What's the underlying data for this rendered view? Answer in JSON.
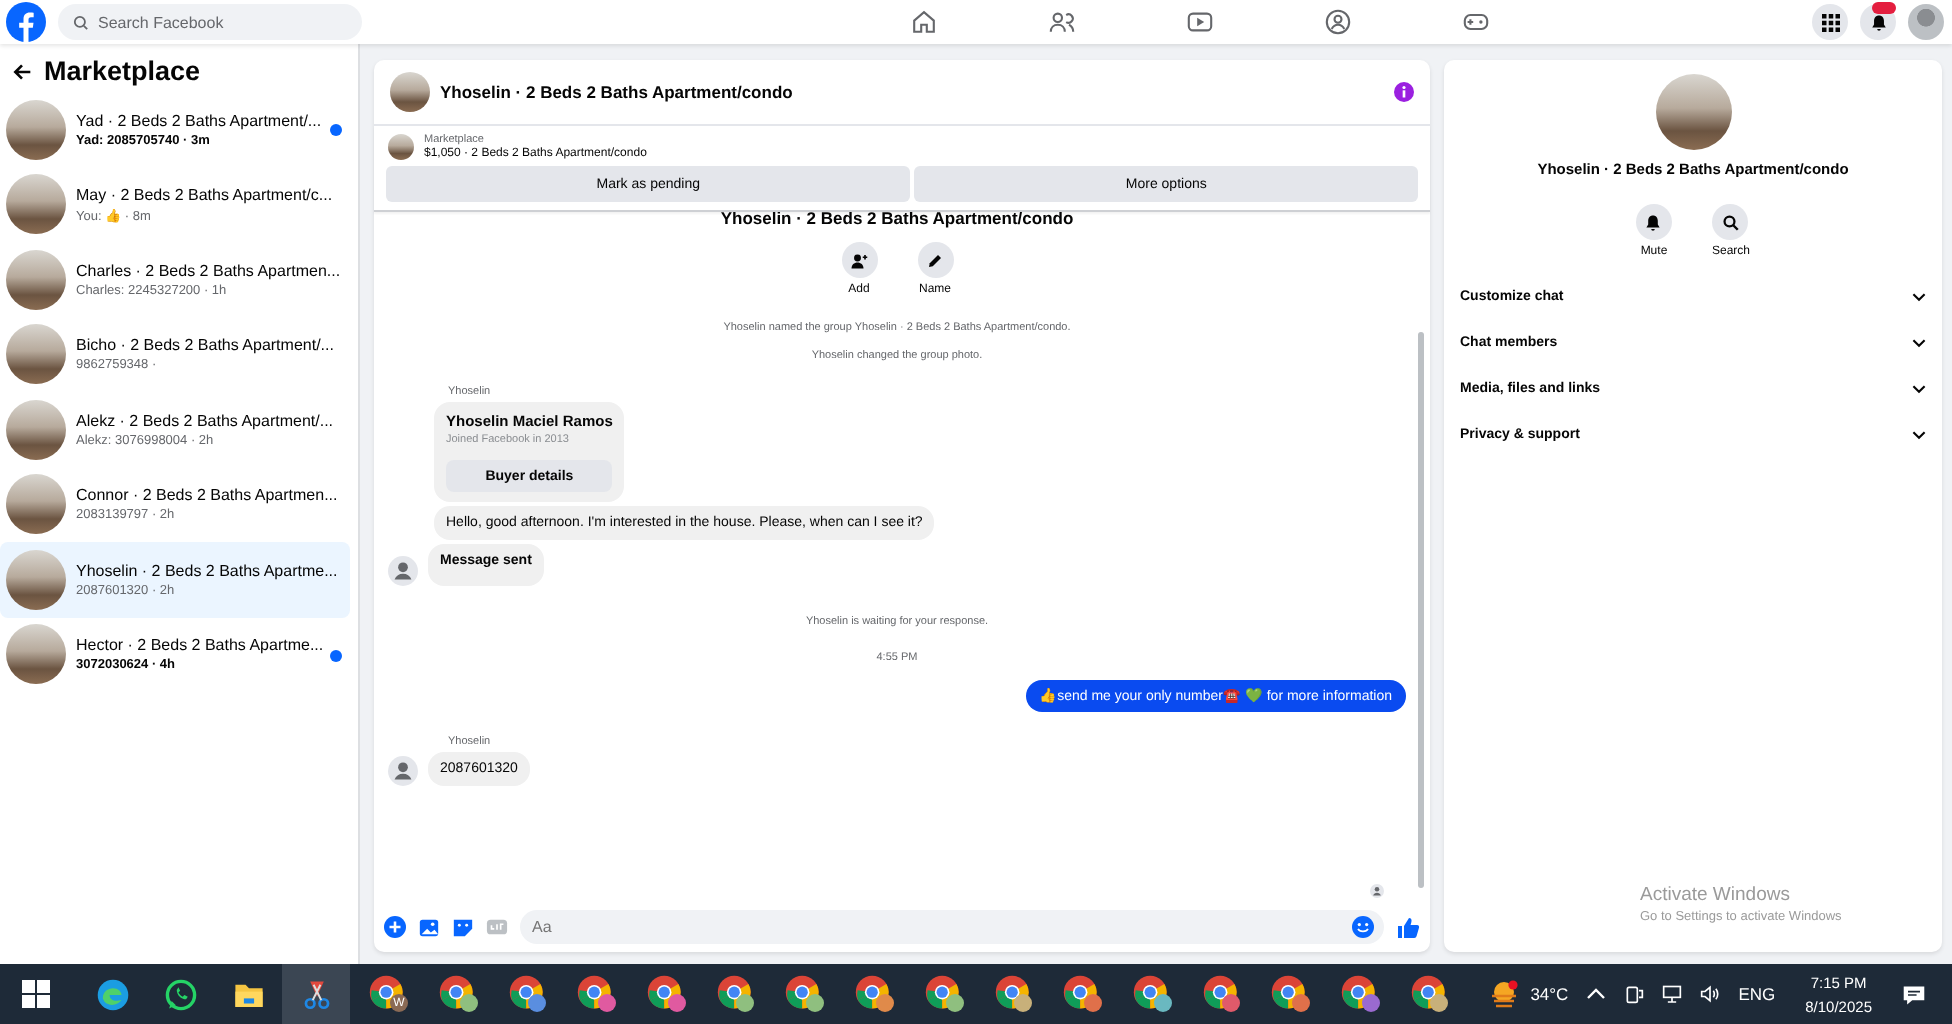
{
  "topbar": {
    "search": {
      "placeholder": "Search Facebook"
    }
  },
  "sidebar": {
    "title": "Marketplace",
    "conversations": [
      {
        "title": "Yad · 2 Beds 2 Baths Apartment/...",
        "preview": "Yad: 2085705740 · 3m",
        "unread": true,
        "selected": false
      },
      {
        "title": "May · 2 Beds 2 Baths Apartment/c...",
        "preview": "You: 👍 · 8m",
        "unread": false,
        "selected": false
      },
      {
        "title": "Charles · 2 Beds 2 Baths Apartmen...",
        "preview": "Charles: 2245327200 · 1h",
        "unread": false,
        "selected": false
      },
      {
        "title": "Bicho · 2 Beds 2 Baths Apartment/...",
        "preview": "9862759348 ·",
        "unread": false,
        "selected": false
      },
      {
        "title": "Alekz · 2 Beds 2 Baths Apartment/...",
        "preview": "Alekz: 3076998004 · 2h",
        "unread": false,
        "selected": false
      },
      {
        "title": "Connor · 2 Beds 2 Baths Apartmen...",
        "preview": "2083139797 · 2h",
        "unread": false,
        "selected": false
      },
      {
        "title": "Yhoselin · 2 Beds 2 Baths Apartme...",
        "preview": "2087601320 · 2h",
        "unread": false,
        "selected": true
      },
      {
        "title": "Hector · 2 Beds 2 Baths Apartme...",
        "preview": "3072030624 · 4h",
        "unread": true,
        "selected": false
      }
    ]
  },
  "chat": {
    "title": "Yhoselin · 2 Beds 2 Baths Apartment/condo",
    "listing": {
      "source": "Marketplace",
      "summary": "$1,050 · 2 Beds 2 Baths Apartment/condo"
    },
    "actions": [
      "Mark as pending",
      "More options"
    ],
    "group_heading": "Yhoselin · 2 Beds 2 Baths Apartment/condo",
    "group_actions": [
      {
        "kind": "add",
        "label": "Add"
      },
      {
        "kind": "name",
        "label": "Name"
      }
    ],
    "messages": [
      {
        "kind": "system",
        "text": "Yhoselin named the group Yhoselin · 2 Beds 2 Baths Apartment/condo."
      },
      {
        "kind": "system",
        "text": "Yhoselin changed the group photo."
      },
      {
        "kind": "sender",
        "text": "Yhoselin"
      },
      {
        "kind": "card",
        "name": "Yhoselin Maciel Ramos",
        "detail": "Joined Facebook in 2013",
        "button": "Buyer details"
      },
      {
        "kind": "incoming",
        "text": "Hello, good afternoon. I'm interested in the house. Please, when can I see it?",
        "avatar": false,
        "bold": false
      },
      {
        "kind": "incoming",
        "text": "Message sent",
        "avatar": true,
        "bold": true
      },
      {
        "kind": "system",
        "text": "Yhoselin is waiting for your response."
      },
      {
        "kind": "time",
        "text": "4:55 PM"
      },
      {
        "kind": "outgoing",
        "text": "👍send me your only number☎️ 💚 for more information"
      },
      {
        "kind": "sender",
        "text": "Yhoselin"
      },
      {
        "kind": "incoming",
        "text": "2087601320",
        "avatar": true,
        "bold": false
      }
    ],
    "composer": {
      "placeholder": "Aa"
    }
  },
  "details": {
    "title": "Yhoselin · 2 Beds 2 Baths Apartment/condo",
    "actions": [
      {
        "kind": "mute",
        "label": "Mute"
      },
      {
        "kind": "search",
        "label": "Search"
      }
    ],
    "sections": [
      {
        "label": "Customize chat",
        "expanded": false
      },
      {
        "label": "Chat members",
        "expanded": false
      },
      {
        "label": "Media, files and links",
        "expanded": false
      },
      {
        "label": "Privacy & support",
        "expanded": false
      }
    ]
  },
  "activation": {
    "title": "Activate Windows",
    "hint": "Go to Settings to activate Windows"
  },
  "taskbar": {
    "apps": [
      {
        "kind": "chrome",
        "color": "#8a6a55",
        "badge": "W"
      },
      {
        "kind": "chrome",
        "color": "#8fbf7f"
      },
      {
        "kind": "chrome",
        "color": "#5a8ee0"
      },
      {
        "kind": "chrome",
        "color": "#e05aa0"
      },
      {
        "kind": "chrome",
        "color": "#e05aa0"
      },
      {
        "kind": "chrome",
        "color": "#8fbf7f"
      },
      {
        "kind": "chrome",
        "color": "#8fbf7f"
      },
      {
        "kind": "chrome",
        "color": "#e08a4a"
      },
      {
        "kind": "chrome",
        "color": "#8fbf7f"
      },
      {
        "kind": "chrome",
        "color": "#c8b07a"
      },
      {
        "kind": "chrome",
        "color": "#e0704a"
      },
      {
        "kind": "chrome",
        "color": "#6ab8c0"
      },
      {
        "kind": "chrome",
        "color": "#e05a6a"
      },
      {
        "kind": "chrome",
        "color": "#e0704a"
      },
      {
        "kind": "chrome",
        "color": "#9a6ad0"
      },
      {
        "kind": "chrome",
        "color": "#c8b07a"
      }
    ],
    "weather": "34°C",
    "language": "ENG",
    "time": "7:15 PM",
    "date": "8/10/2025"
  }
}
